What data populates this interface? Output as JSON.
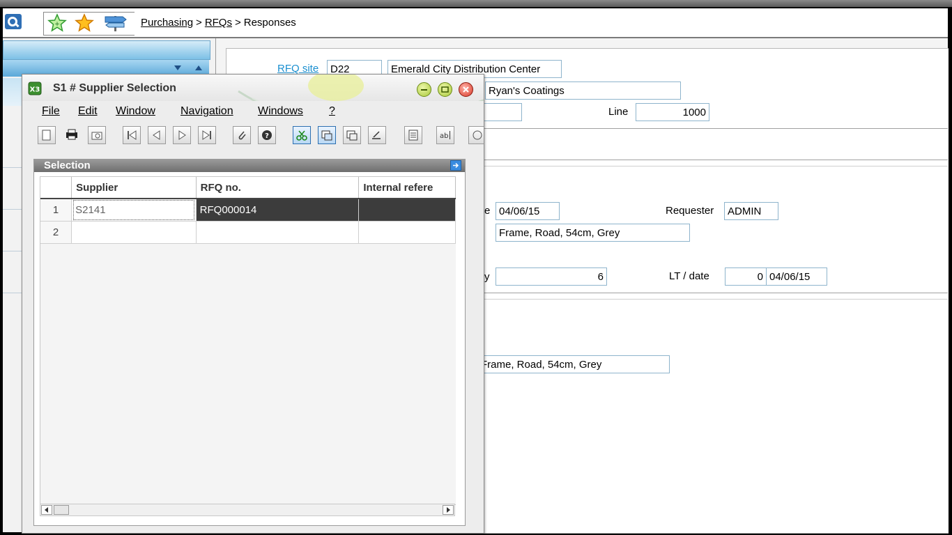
{
  "breadcrumb": {
    "items": [
      "Purchasing",
      "RFQs"
    ],
    "current": "Responses",
    "separator": ">"
  },
  "dialog": {
    "title": "S1 # Supplier Selection",
    "menu": [
      "File",
      "Edit",
      "Window",
      "Navigation",
      "Windows",
      "?"
    ],
    "selection_title": "Selection",
    "columns": [
      "Supplier",
      "RFQ no.",
      "Internal refere"
    ],
    "rows": [
      {
        "num": "1",
        "supplier": "S2141",
        "rfq": "RFQ000014",
        "internal_ref": ""
      },
      {
        "num": "2",
        "supplier": "",
        "rfq": "",
        "internal_ref": ""
      }
    ]
  },
  "form": {
    "rfq_site_label": "RFQ site",
    "rfq_site_code": "D22",
    "rfq_site_name": "Emerald City Distribution Center",
    "supplier_name": "Ryan's Coatings",
    "line_label": "Line",
    "line_value": "1000",
    "date_label_tail": "e",
    "date_value": "04/06/15",
    "requester_label": "Requester",
    "requester_value": "ADMIN",
    "description": "Frame, Road, 54cm, Grey",
    "qty_label_tail": "y",
    "qty_value": "6",
    "lt_label": "LT / date",
    "lt_value": "0",
    "lt_date": "04/06/15",
    "description2": "Frame, Road, 54cm, Grey"
  },
  "colors": {
    "link": "#1a8fd0",
    "field_border": "#8eb4cc",
    "selected_row": "#3c3c3c",
    "panel_blue": "#7cc0e6"
  }
}
